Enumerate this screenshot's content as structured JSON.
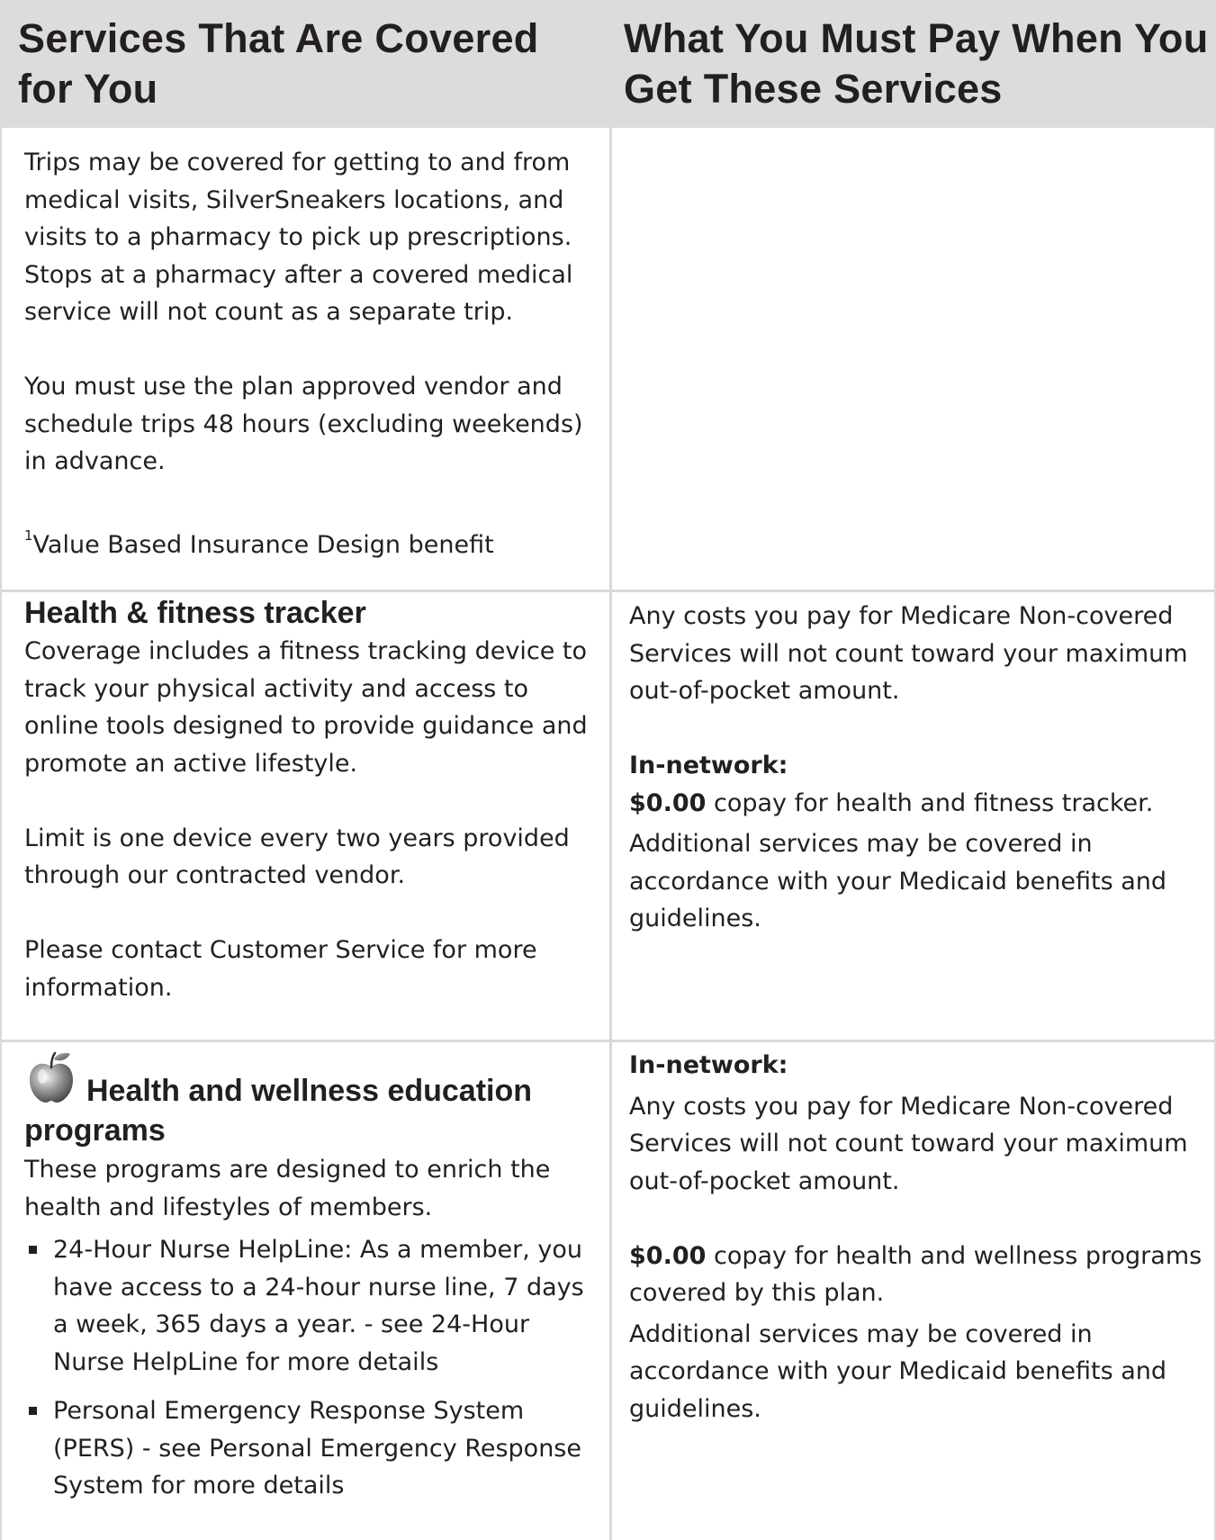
{
  "header": {
    "left": "Services That Are Covered for You",
    "right": "What You Must Pay When You Get These Services"
  },
  "transport": {
    "para1": "Trips may be covered for getting to and from medical visits, SilverSneakers locations, and visits to a pharmacy to pick up prescriptions. Stops at a pharmacy after a covered medical service will not count as a separate trip.",
    "para2": "You must use the plan approved vendor and schedule trips 48 hours (excluding weekends) in advance.",
    "footnote_marker": "1",
    "footnote": "Value Based Insurance Design benefit"
  },
  "fitness": {
    "title": "Health & fitness tracker",
    "para1": "Coverage includes a fitness tracking device to track your physical activity and access to online tools designed to provide guidance and promote an active lifestyle.",
    "para2": "Limit is one device every two years provided through our contracted vendor.",
    "para3": "Please contact Customer Service for more information.",
    "cost_para1": "Any costs you pay for Medicare Non-covered Services will not count toward your maximum out-of-pocket amount.",
    "in_network_label": "In-network:",
    "copay_amount": "$0.00",
    "copay_text": " copay for health and fitness tracker.",
    "additional": "Additional services may be covered in accordance with your Medicaid benefits and guidelines."
  },
  "wellness": {
    "icon": "apple-icon",
    "title": "Health and wellness education programs",
    "intro": "These programs are designed to enrich the health and lifestyles of members.",
    "bullets": [
      "24-Hour Nurse HelpLine: As a member, you have access to a 24-hour nurse line, 7 days a week, 365 days a year. - see 24-Hour Nurse HelpLine for more details",
      "Personal Emergency Response System (PERS) - see Personal Emergency Response System for more details"
    ],
    "in_network_label": "In-network:",
    "cost_para1": "Any costs you pay for Medicare Non-covered Services will not count toward your maximum out-of-pocket amount.",
    "copay_amount": "$0.00",
    "copay_text": " copay for health and wellness programs covered by this plan.",
    "additional": "Additional services may be covered in accordance with your Medicaid benefits and guidelines."
  }
}
